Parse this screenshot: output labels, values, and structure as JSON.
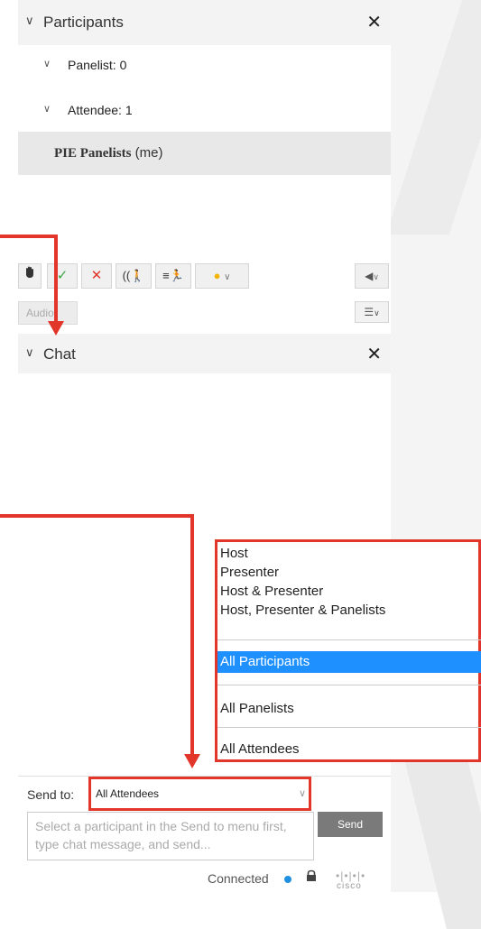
{
  "participants": {
    "title": "Participants",
    "panelist_label": "Panelist: 0",
    "attendee_label": "Attendee: 1",
    "me_name": "PIE Panelists",
    "me_suffix": "(me)"
  },
  "toolbar": {
    "audio_label": "Audio",
    "icons": [
      "raise-hand-icon",
      "check-icon",
      "x-icon",
      "go-faster-icon",
      "go-slower-icon",
      "emoji-icon",
      "announce-icon",
      "list-icon"
    ]
  },
  "chat": {
    "title": "Chat",
    "send_to_label": "Send to:",
    "send_to_value": "All Attendees",
    "message_placeholder": "Select a participant in the Send to menu first, type chat message, and send...",
    "send_button": "Send"
  },
  "dropdown": {
    "options": [
      "Host",
      "Presenter",
      "Host & Presenter",
      "Host, Presenter & Panelists",
      "All Participants",
      "All Panelists",
      "All Attendees"
    ],
    "selected": "All Participants"
  },
  "status": {
    "text": "Connected",
    "brand": "cisco"
  },
  "colors": {
    "annotation_red": "#e2362b",
    "selection_blue": "#1e90ff",
    "status_dot": "#1f8fe0"
  }
}
